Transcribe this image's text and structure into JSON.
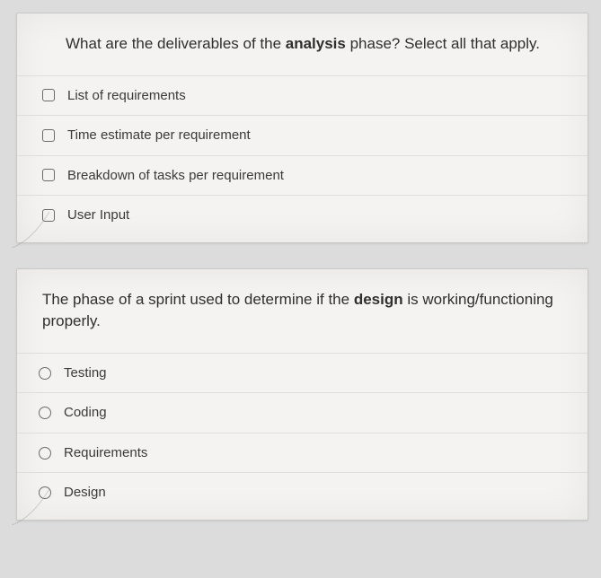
{
  "q1": {
    "prompt_pre": "What are the deliverables of the ",
    "prompt_strong": "analysis",
    "prompt_post": " phase? Select all that apply.",
    "options": [
      "List of requirements",
      "Time estimate per requirement",
      "Breakdown of tasks per requirement",
      "User Input"
    ]
  },
  "q2": {
    "prompt_pre": "The phase of a sprint used to determine if the ",
    "prompt_strong": "design",
    "prompt_post": " is working/functioning properly.",
    "options": [
      "Testing",
      "Coding",
      "Requirements",
      "Design"
    ]
  }
}
